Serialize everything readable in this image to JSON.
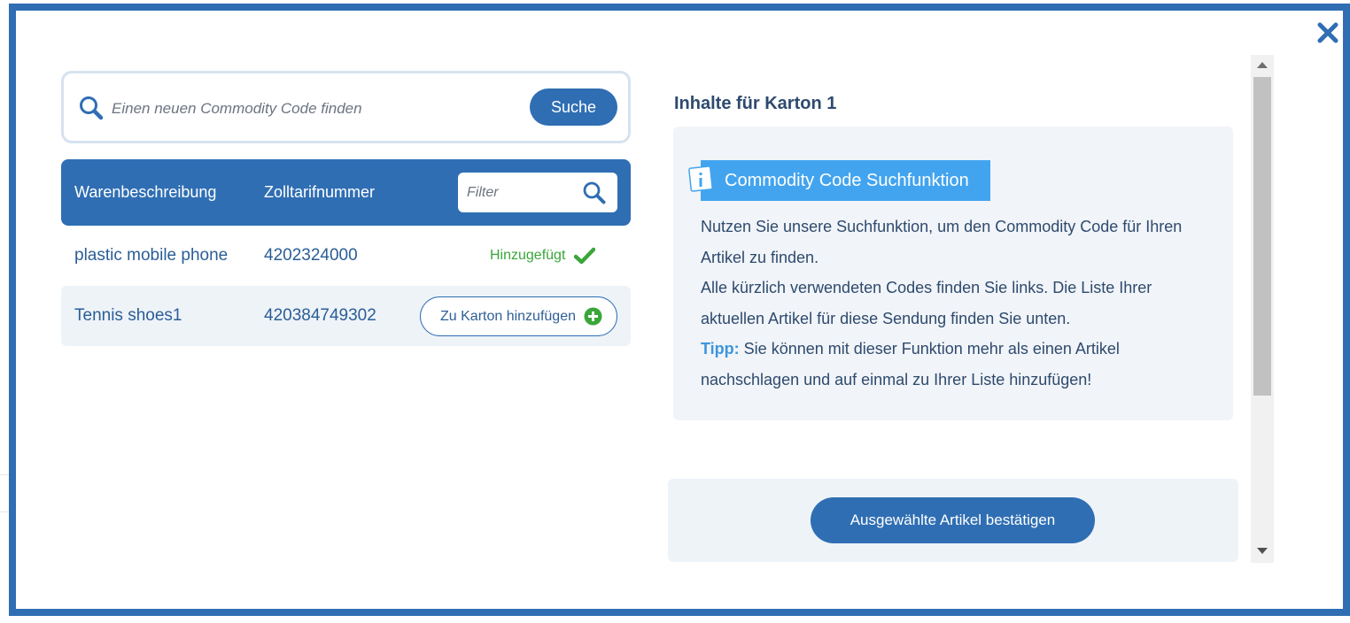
{
  "colors": {
    "primary": "#2f6eb3",
    "info_header": "#42a4ef",
    "success": "#3aa63a",
    "panel_bg": "#f1f4f8",
    "text_dark": "#2e4a6e"
  },
  "modal": {
    "close_icon": "close-x-icon"
  },
  "search": {
    "placeholder": "Einen neuen Commodity Code finden",
    "value": "",
    "button_label": "Suche",
    "icon": "search-icon"
  },
  "table": {
    "headers": {
      "description": "Warenbeschreibung",
      "tariff_number": "Zolltarifnummer"
    },
    "filter": {
      "placeholder": "Filter",
      "icon": "search-icon"
    },
    "rows": [
      {
        "description": "plastic mobile phone",
        "tariff_number": "4202324000",
        "status": "Hinzugefügt",
        "status_icon": "checkmark-icon"
      },
      {
        "description": "Tennis shoes1",
        "tariff_number": "420384749302",
        "action_label": "Zu Karton hinzufügen",
        "action_icon": "plus-circle-icon"
      }
    ]
  },
  "right_panel": {
    "title": "Inhalte für Karton 1",
    "info": {
      "icon": "info-icon",
      "heading": "Commodity Code Suchfunktion",
      "paragraph_1": "Nutzen Sie unsere Suchfunktion, um den Commodity Code für Ihren Artikel zu finden.",
      "paragraph_2": "Alle kürzlich verwendeten Codes finden Sie links. Die Liste Ihrer aktuellen Artikel für diese Sendung finden Sie unten.",
      "tip_label": "Tipp:",
      "tip_text": "Sie können mit dieser Funktion mehr als einen Artikel nachschlagen und auf einmal zu Ihrer Liste hinzufügen!"
    },
    "confirm_button_label": "Ausgewählte Artikel bestätigen"
  }
}
